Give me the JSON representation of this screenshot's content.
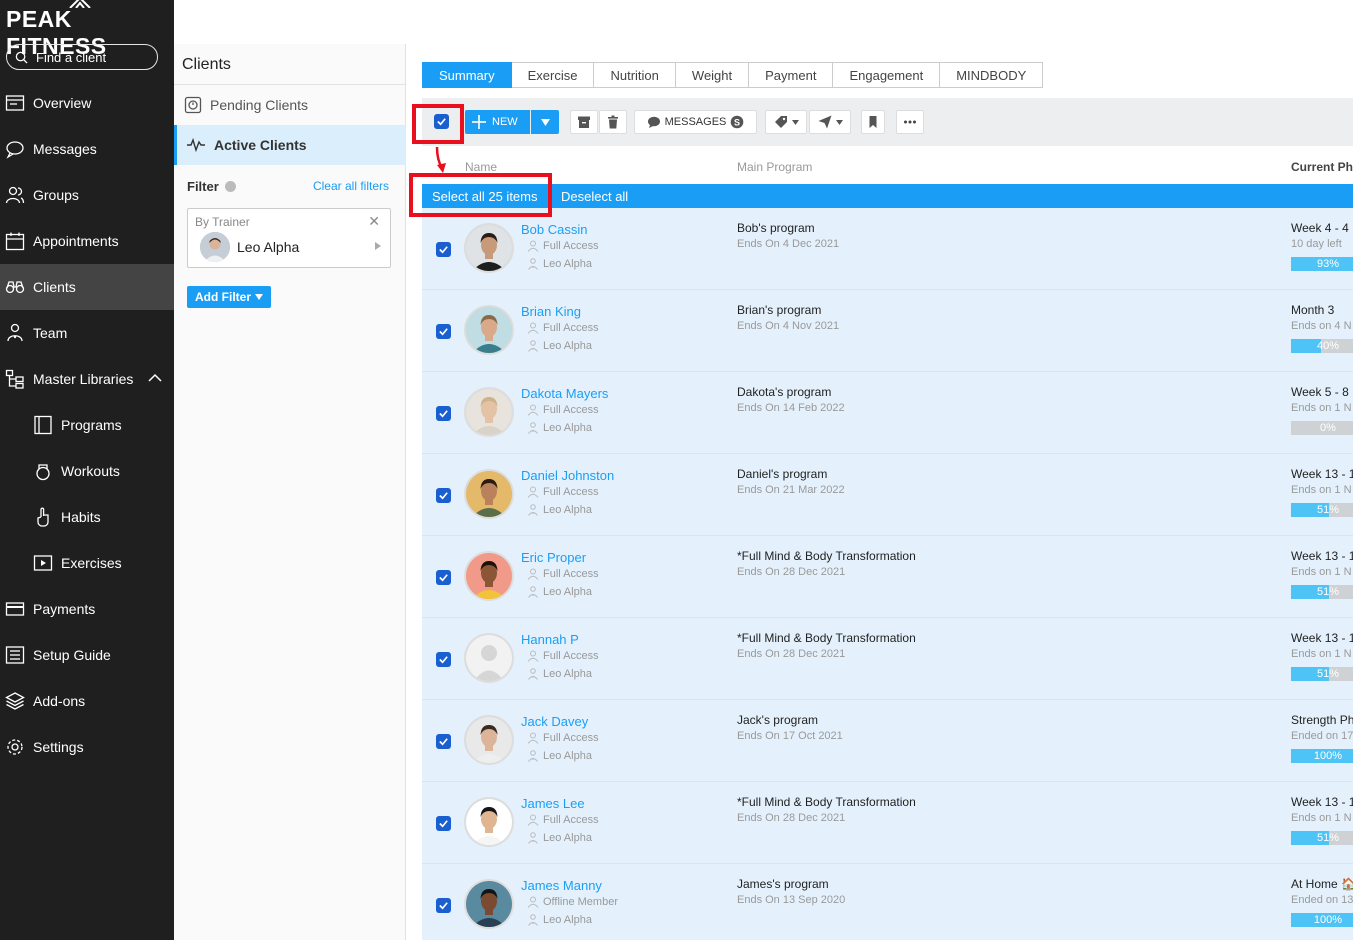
{
  "app": {
    "brand": "PEAK FITNESS",
    "search_placeholder": "Find a client"
  },
  "nav": {
    "items": [
      {
        "label": "Overview"
      },
      {
        "label": "Messages"
      },
      {
        "label": "Groups"
      },
      {
        "label": "Appointments"
      },
      {
        "label": "Clients"
      },
      {
        "label": "Team"
      },
      {
        "label": "Master Libraries"
      },
      {
        "label": "Programs"
      },
      {
        "label": "Workouts"
      },
      {
        "label": "Habits"
      },
      {
        "label": "Exercises"
      },
      {
        "label": "Payments"
      },
      {
        "label": "Setup Guide"
      },
      {
        "label": "Add-ons"
      },
      {
        "label": "Settings"
      }
    ]
  },
  "panel": {
    "title": "Clients",
    "pending": "Pending Clients",
    "active": "Active Clients",
    "filter_label": "Filter",
    "clear_filters": "Clear all filters",
    "trainer_filter_label": "By Trainer",
    "trainer_name": "Leo Alpha",
    "add_filter": "Add Filter"
  },
  "tabs": [
    "Summary",
    "Exercise",
    "Nutrition",
    "Weight",
    "Payment",
    "Engagement",
    "MINDBODY"
  ],
  "toolbar": {
    "new_label": "NEW",
    "messages_label": "MESSAGES"
  },
  "list": {
    "col_name": "Name",
    "col_program": "Main Program",
    "col_phase": "Current Ph",
    "select_all": "Select all 25 items",
    "deselect_all": "Deselect all"
  },
  "clients": [
    {
      "name": "Bob Cassin",
      "access": "Full Access",
      "trainer": "Leo Alpha",
      "program": "Bob's program",
      "ends": "Ends On 4 Dec 2021",
      "phase": "Week 4 - 4",
      "phase_sub": "10 day left",
      "progress": 93,
      "progress_label": "93%",
      "skin": "#c79a7a",
      "hair": "#2b1d14",
      "shirt": "#1e1e1e",
      "bg": "#dfe3e6"
    },
    {
      "name": "Brian King",
      "access": "Full Access",
      "trainer": "Leo Alpha",
      "program": "Brian's program",
      "ends": "Ends On 4 Nov 2021",
      "phase": "Month 3",
      "phase_sub": "Ends on 4 N",
      "progress": 40,
      "progress_label": "40%",
      "skin": "#d9a98a",
      "hair": "#8a6a4a",
      "shirt": "#3a7d8c",
      "bg": "#bfdde3"
    },
    {
      "name": "Dakota Mayers",
      "access": "Full Access",
      "trainer": "Leo Alpha",
      "program": "Dakota's program",
      "ends": "Ends On 14 Feb 2022",
      "phase": "Week 5 - 8",
      "phase_sub": "Ends on 1 N",
      "progress": 0,
      "progress_label": "0%",
      "skin": "#e3c2a6",
      "hair": "#cdb28a",
      "shirt": "#d9d2c8",
      "bg": "#e8e3dc"
    },
    {
      "name": "Daniel Johnston",
      "access": "Full Access",
      "trainer": "Leo Alpha",
      "program": "Daniel's program",
      "ends": "Ends On 21 Mar 2022",
      "phase": "Week 13 - 1",
      "phase_sub": "Ends on 1 N",
      "progress": 51,
      "progress_label": "51%",
      "skin": "#b9825c",
      "hair": "#2a1c12",
      "shirt": "#5b6e4a",
      "bg": "#e4b96a"
    },
    {
      "name": "Eric Proper",
      "access": "Full Access",
      "trainer": "Leo Alpha",
      "program": "*Full Mind & Body Transformation",
      "ends": "Ends On 28 Dec 2021",
      "phase": "Week 13 - 1",
      "phase_sub": "Ends on 1 N",
      "progress": 51,
      "progress_label": "51%",
      "skin": "#8a5636",
      "hair": "#1b120c",
      "shirt": "#f2c23a",
      "bg": "#f29a8a"
    },
    {
      "name": "Hannah P",
      "access": "Full Access",
      "trainer": "Leo Alpha",
      "program": "*Full Mind & Body Transformation",
      "ends": "Ends On 28 Dec 2021",
      "phase": "Week 13 - 1",
      "phase_sub": "Ends on 1 N",
      "progress": 51,
      "progress_label": "51%",
      "skin": "#d6d6d6",
      "hair": "#d6d6d6",
      "shirt": "#d6d6d6",
      "bg": "#f2f2f2"
    },
    {
      "name": "Jack Davey",
      "access": "Full Access",
      "trainer": "Leo Alpha",
      "program": "Jack's program",
      "ends": "Ends On 17 Oct 2021",
      "phase": "Strength Ph",
      "phase_sub": "Ended on 17",
      "progress": 100,
      "progress_label": "100%",
      "skin": "#dcb49a",
      "hair": "#3b2a20",
      "shirt": "#eeeeee",
      "bg": "#e9e9e9"
    },
    {
      "name": "James Lee",
      "access": "Full Access",
      "trainer": "Leo Alpha",
      "program": "*Full Mind & Body Transformation",
      "ends": "Ends On 28 Dec 2021",
      "phase": "Week 13 - 1",
      "phase_sub": "Ends on 1 N",
      "progress": 51,
      "progress_label": "51%",
      "skin": "#e0b592",
      "hair": "#151515",
      "shirt": "#f5f5f5",
      "bg": "#ffffff"
    },
    {
      "name": "James Manny",
      "access": "Offline Member",
      "trainer": "Leo Alpha",
      "program": "James's program",
      "ends": "Ends On 13 Sep 2020",
      "phase": "At Home 🏠",
      "phase_sub": "Ended on 13",
      "progress": 100,
      "progress_label": "100%",
      "skin": "#7a4b30",
      "hair": "#141414",
      "shirt": "#2a3f52",
      "bg": "#5a8aa0"
    }
  ],
  "colors": {
    "accent": "#1a9ef5",
    "sidebar_bg": "#1f1f1f",
    "row_bg": "#e4f1fd",
    "progress_fill": "#4ec3f5",
    "annotation": "#e8101e"
  }
}
